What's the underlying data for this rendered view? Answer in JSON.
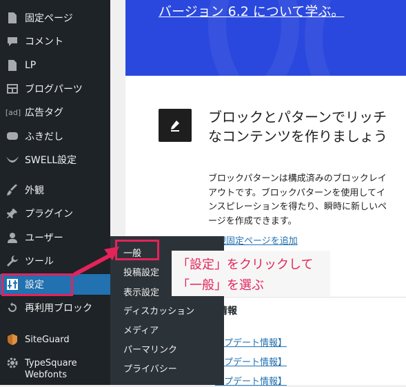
{
  "sidebar": {
    "items": [
      {
        "icon": "page-icon",
        "label": "固定ページ"
      },
      {
        "icon": "comment-icon",
        "label": "コメント"
      },
      {
        "icon": "page-icon",
        "label": "LP"
      },
      {
        "icon": "grid-icon",
        "label": "ブログパーツ"
      },
      {
        "icon": "ad-icon",
        "label": "広告タグ"
      },
      {
        "icon": "speech-bubble-icon",
        "label": "ふきだし"
      },
      {
        "icon": "swallow-icon",
        "label": "SWELL設定"
      },
      {
        "icon": "brush-icon",
        "label": "外観"
      },
      {
        "icon": "plugin-icon",
        "label": "プラグイン"
      },
      {
        "icon": "user-icon",
        "label": "ユーザー"
      },
      {
        "icon": "wrench-icon",
        "label": "ツール"
      },
      {
        "icon": "settings-sliders-icon",
        "label": "設定"
      },
      {
        "icon": "reuse-icon",
        "label": "再利用ブロック"
      },
      {
        "icon": "siteguard-icon",
        "label": "SiteGuard"
      },
      {
        "icon": "gear-icon",
        "label": "TypeSquare",
        "label2": "Webfonts"
      }
    ]
  },
  "hero": {
    "link": "バージョン 6.2 について学ぶ。"
  },
  "card": {
    "icon": "pencil-icon",
    "title": "ブロックとパターンでリッチなコンテンツを作りましょう",
    "description": "ブロックパターンは構成済みのブロックレイアウトです。ブロックパターンを使用してインスピレーションを得たり、瞬時に新しいページを作成できます。",
    "link": "新規固定ページを追加"
  },
  "site_info": {
    "title": "ト情報",
    "links": [
      "ップデート情報】",
      "ップデート情報】",
      "ップデート情報】"
    ]
  },
  "submenu": {
    "items": [
      "一般",
      "投稿設定",
      "表示設定",
      "ディスカッション",
      "メディア",
      "パーマリンク",
      "プライバシー"
    ]
  },
  "annotation": {
    "line1": "「設定」をクリックして",
    "line2": "「一般」を選ぶ"
  },
  "colors": {
    "sidebar_bg": "#1d2327",
    "active": "#2271b1",
    "accent": "#e4235a",
    "hero": "#2a48dd"
  }
}
